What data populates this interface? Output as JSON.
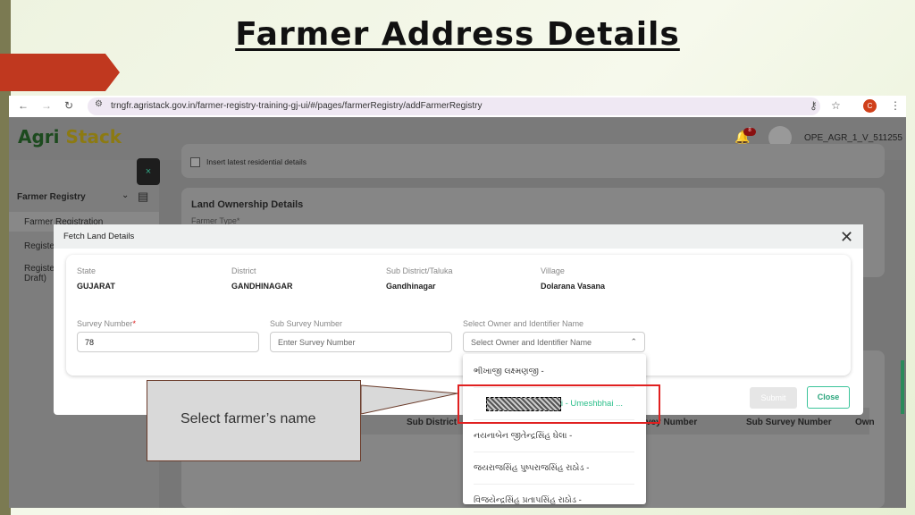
{
  "slide": {
    "title": "Farmer Address Details",
    "callout": "Select farmer’s name"
  },
  "browser": {
    "url": "trngfr.agristack.gov.in/farmer-registry-training-gj-ui/#/pages/farmerRegistry/addFarmerRegistry",
    "profile_initial": "C"
  },
  "app": {
    "logo_a": "Agri",
    "logo_b": "Stack",
    "user": "OPE_AGR_1_V_511255",
    "notification_count": "8"
  },
  "sidebar": {
    "section": "Farmer Registry",
    "items": [
      "Farmer Registration",
      "Registe",
      "Registe\nDraft)"
    ]
  },
  "background": {
    "checkbox_label": "Insert latest residential details",
    "land_title": "Land Ownership Details",
    "farmer_type": "Farmer Type*",
    "cols": [
      "Sub District",
      "vey Number",
      "Sub Survey Number",
      "Own"
    ]
  },
  "modal": {
    "title": "Fetch Land Details",
    "fields": [
      {
        "label": "State",
        "value": "GUJARAT"
      },
      {
        "label": "District",
        "value": "GANDHINAGAR"
      },
      {
        "label": "Sub District/Taluka",
        "value": "Gandhinagar"
      },
      {
        "label": "Village",
        "value": "Dolarana Vasana"
      }
    ],
    "survey_label": "Survey Number",
    "survey_value": "78",
    "sub_survey_label": "Sub Survey Number",
    "sub_survey_placeholder": "Enter Survey Number",
    "owner_label": "Select Owner and Identifier Name",
    "owner_placeholder": "Select Owner and Identifier Name",
    "submit": "Submit",
    "close": "Close",
    "options": [
      "ભીખાજી લક્ષ્મણજી -",
      "bhai - Umeshbhai ...",
      "નયનાબેન જીતેન્દ્રસિંહ ઘેલા -",
      "જયરાજસિંહ પુષ્પરાજસિંહ રાઠોડ -",
      "વિજયેન્દ્રસિંહ પ્રતાપસિંહ રાઠોડ -"
    ]
  },
  "colors": {
    "accent": "#2aa57c",
    "highlight": "#e02020",
    "arrow": "#c0381f"
  }
}
